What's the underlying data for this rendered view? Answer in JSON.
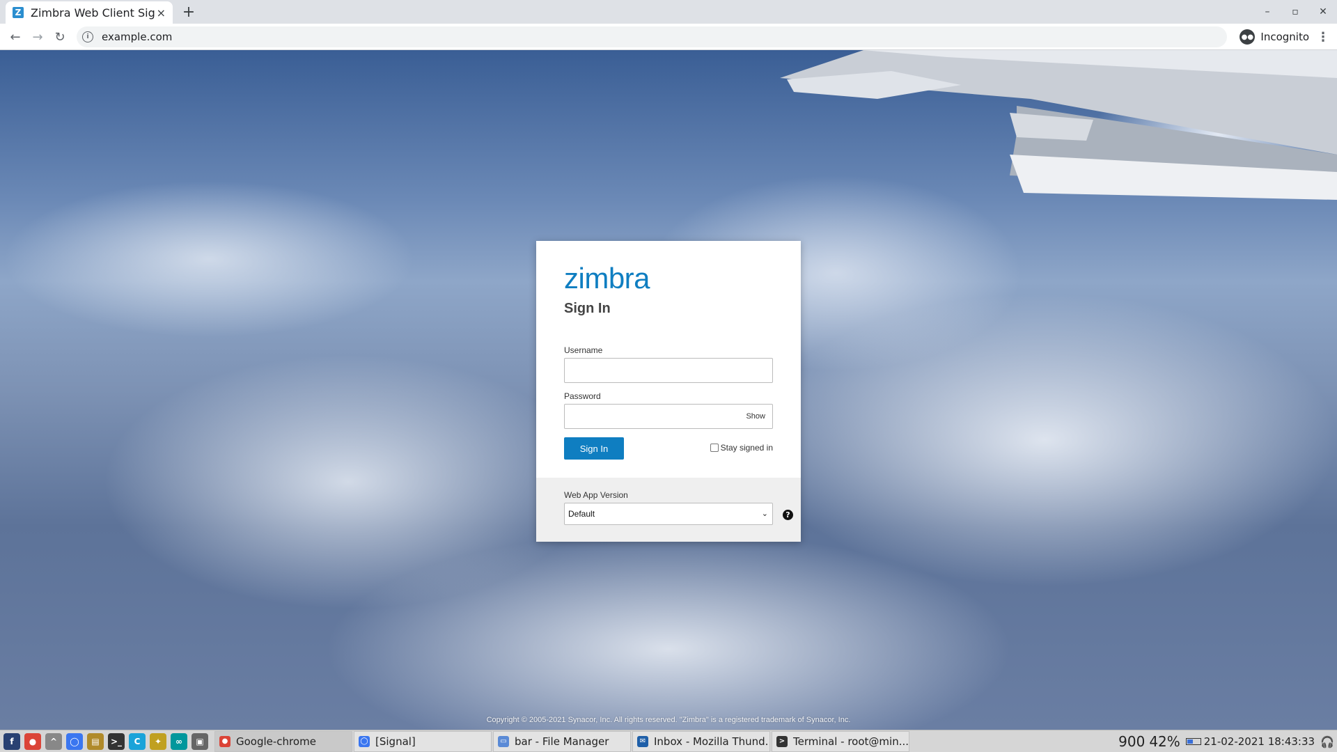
{
  "browser": {
    "tab": {
      "favicon_letter": "Z",
      "title": "Zimbra Web Client Sign In",
      "close": "×"
    },
    "new_tab": "+",
    "window_controls": {
      "minimize": "–",
      "maximize": "▫",
      "close": "✕"
    },
    "nav": {
      "back": "←",
      "forward": "→",
      "reload": "↻"
    },
    "address": {
      "url": "example.com",
      "site_info_icon": "i"
    },
    "incognito_label": "Incognito",
    "menu": "⋮"
  },
  "login": {
    "logo": "zimbra",
    "title": "Sign In",
    "username": {
      "label": "Username",
      "value": ""
    },
    "password": {
      "label": "Password",
      "value": "",
      "show_label": "Show"
    },
    "sign_in_button": "Sign In",
    "stay_signed_in": {
      "label": "Stay signed in",
      "checked": false
    },
    "web_app_version": {
      "label": "Web App Version",
      "selected": "Default"
    },
    "help": "?"
  },
  "footer": {
    "copyright": "Copyright © 2005-2021 Synacor, Inc. All rights reserved. \"Zimbra\" is a registered trademark of Synacor, Inc."
  },
  "taskbar": {
    "launchers": [
      {
        "name": "fedora-icon",
        "glyph": "f",
        "color": "#294172"
      },
      {
        "name": "chrome-icon",
        "glyph": "●",
        "color": "#db4437"
      },
      {
        "name": "expand-icon",
        "glyph": "^",
        "color": "#888888"
      },
      {
        "name": "signal-icon",
        "glyph": "◯",
        "color": "#3a76f0"
      },
      {
        "name": "notes-icon",
        "glyph": "▤",
        "color": "#b08a2a"
      },
      {
        "name": "terminal-icon",
        "glyph": ">_",
        "color": "#333333"
      },
      {
        "name": "ccleaner-icon",
        "glyph": "C",
        "color": "#1aa3d9"
      },
      {
        "name": "puzzle-icon",
        "glyph": "✦",
        "color": "#c0a020"
      },
      {
        "name": "arduino-icon",
        "glyph": "∞",
        "color": "#00979c"
      },
      {
        "name": "screenshot-icon",
        "glyph": "▣",
        "color": "#666666"
      }
    ],
    "tasks": [
      {
        "label": "Google-chrome",
        "icon": "chrome-icon",
        "color": "#db4437",
        "glyph": "●",
        "active": true
      },
      {
        "label": "[Signal]",
        "icon": "signal-icon",
        "color": "#3a76f0",
        "glyph": "◯",
        "active": false
      },
      {
        "label": "bar - File Manager",
        "icon": "folder-icon",
        "color": "#5a8ad6",
        "glyph": "▭",
        "active": false
      },
      {
        "label": "Inbox - Mozilla Thund...",
        "icon": "thunderbird-icon",
        "color": "#1f5fa8",
        "glyph": "✉",
        "active": false
      },
      {
        "label": "Terminal - root@min...",
        "icon": "terminal-icon",
        "color": "#333333",
        "glyph": ">",
        "active": false
      }
    ],
    "tray": {
      "left_value": "900",
      "battery_percent": "42%",
      "datetime": "21-02-2021 18:43:33",
      "headphones_icon": "headphones-icon"
    }
  }
}
